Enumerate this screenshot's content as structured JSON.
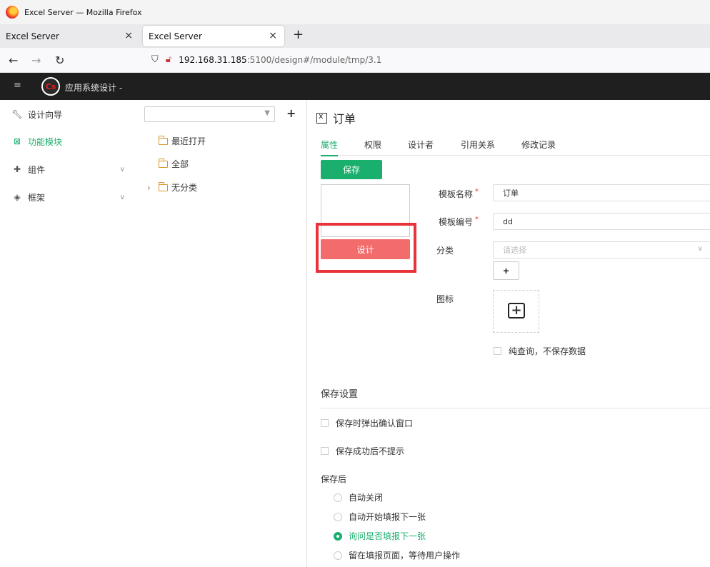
{
  "browser": {
    "window_title": "Excel Server — Mozilla Firefox",
    "tabs": [
      {
        "label": "Excel Server",
        "active": false
      },
      {
        "label": "Excel Server",
        "active": true
      }
    ],
    "tab_close_glyph": "×",
    "new_tab_glyph": "+",
    "url_host": "192.168.31.185",
    "url_path": ":5100/design#/module/tmp/3.1",
    "nav_icons": [
      "back-arrow-icon",
      "forward-arrow-icon",
      "reload-icon",
      "shield-icon",
      "insecure-lock-icon"
    ]
  },
  "app": {
    "title": "应用系统设计 -",
    "logo_text": "Cs"
  },
  "sidebar": {
    "items": [
      {
        "label": "设计向导",
        "icon": "wrench-icon",
        "active": false
      },
      {
        "label": "功能模块",
        "icon": "module-icon",
        "active": true
      },
      {
        "label": "组件",
        "icon": "puzzle-icon",
        "active": false,
        "expandable": true
      },
      {
        "label": "框架",
        "icon": "cube-icon",
        "active": false,
        "expandable": true
      }
    ],
    "active_color": "#1aaf6c"
  },
  "tree": {
    "search_placeholder": "",
    "add_glyph": "+",
    "nodes": [
      {
        "label": "最近打开"
      },
      {
        "label": "全部"
      },
      {
        "label": "无分类",
        "collapsible": true
      }
    ]
  },
  "main": {
    "page_title": "订单",
    "tabs": [
      {
        "label": "属性",
        "active": true
      },
      {
        "label": "权限",
        "active": false
      },
      {
        "label": "设计者",
        "active": false
      },
      {
        "label": "引用关系",
        "active": false
      },
      {
        "label": "修改记录",
        "active": false
      }
    ],
    "save_label": "保存",
    "design_label": "设计",
    "fields": {
      "template_name": {
        "label": "模板名称",
        "value": "订单",
        "required_mark": "*"
      },
      "template_code": {
        "label": "模板编号",
        "value": "dd",
        "required_mark": "*"
      },
      "category": {
        "label": "分类",
        "placeholder": "请选择"
      },
      "category_add_glyph": "+",
      "icon_label": "图标",
      "icon_add_glyph": "+"
    },
    "query_only_label": "纯查询，不保存数据",
    "save_settings": {
      "title": "保存设置",
      "confirm_popup_label": "保存时弹出确认窗口",
      "no_prompt_label": "保存成功后不提示",
      "after_save_title": "保存后",
      "options": [
        {
          "label": "自动关闭",
          "checked": false
        },
        {
          "label": "自动开始填报下一张",
          "checked": false
        },
        {
          "label": "询问是否填报下一张",
          "checked": true
        },
        {
          "label": "留在填报页面，等待用户操作",
          "checked": false
        }
      ]
    },
    "colors": {
      "primary": "#1aaf6c",
      "design_button": "#f36c6c",
      "highlight_box": "#e8333a"
    }
  }
}
